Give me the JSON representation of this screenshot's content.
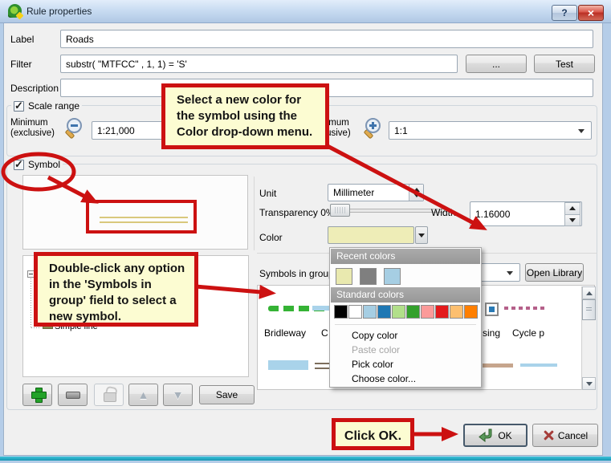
{
  "window": {
    "title": "Rule properties",
    "help": "?",
    "close": "×"
  },
  "form": {
    "label_label": "Label",
    "label_value": "Roads",
    "filter_label": "Filter",
    "filter_value": "substr( \"MTFCC\" , 1, 1) = 'S'",
    "ellipsis_button": "...",
    "test_button": "Test",
    "description_label": "Description",
    "description_value": ""
  },
  "scale_range": {
    "title": "Scale range",
    "min_label_line1": "Minimum",
    "min_label_line2": "(exclusive)",
    "min_value": "1:21,000",
    "max_label_line1": "Maximum",
    "max_label_line2": "(inclusive)",
    "max_value": "1:1"
  },
  "symbol": {
    "title": "Symbol",
    "unit_label": "Unit",
    "unit_value": "Millimeter",
    "transparency_label": "Transparency 0%",
    "width_label": "Width",
    "width_value": "1.16000",
    "color_label": "Color",
    "color_value": "#eeedb7",
    "symbols_in_group_label": "Symbols in group",
    "open_library_button": "Open Library",
    "save_button": "Save",
    "tree_item_label": "Simple line",
    "symbols_row1": [
      {
        "label": "Bridleway"
      },
      {
        "label": "C"
      },
      {
        "label": "sing"
      },
      {
        "label": "Cycle p"
      }
    ]
  },
  "color_menu": {
    "recent_header": "Recent colors",
    "recent_colors": [
      "#e9e9af",
      "#7f7f7f",
      "#a6cee3"
    ],
    "standard_header": "Standard colors",
    "standard_colors": [
      "#000000",
      "#ffffff",
      "#a6cee3",
      "#1f78b4",
      "#b2df8a",
      "#33a02c",
      "#fb9a99",
      "#e31a1c",
      "#fdbf6f",
      "#ff7f00"
    ],
    "items": [
      {
        "label": "Copy color",
        "enabled": true
      },
      {
        "label": "Paste color",
        "enabled": false
      },
      {
        "label": "Pick color",
        "enabled": true
      },
      {
        "label": "Choose color...",
        "enabled": true
      }
    ]
  },
  "dialog_buttons": {
    "ok": "OK",
    "cancel": "Cancel"
  },
  "annotations": {
    "callout_color_text": "Select a new color for the symbol using the Color drop-down menu.",
    "callout_symbols_text": "Double-click any option in the 'Symbols in group' field to select a new symbol.",
    "callout_ok_text": "Click OK.",
    "accent_red": "#cc1111",
    "callout_bg": "#fcfcd2"
  }
}
